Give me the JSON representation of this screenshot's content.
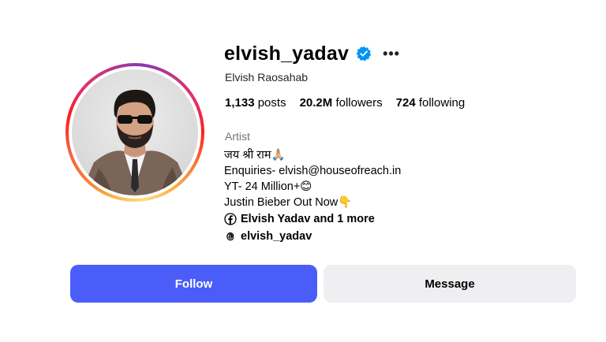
{
  "profile": {
    "username": "elvish_yadav",
    "full_name": "Elvish Raosahab",
    "more_icon": "more-options-icon",
    "verified_icon": "verified-badge-icon",
    "stats": {
      "posts_count": "1,133",
      "posts_label": "posts",
      "followers_count": "20.2M",
      "followers_label": "followers",
      "following_count": "724",
      "following_label": "following"
    },
    "category": "Artist",
    "bio_lines": [
      "जय श्री राम🙏🏼",
      "Enquiries- elvish@houseofreach.in",
      "YT- 24 Million+😊",
      "Justin Bieber Out Now👇"
    ],
    "links": {
      "facebook_text": "Elvish Yadav and 1 more",
      "facebook_icon": "facebook-icon",
      "threads_text": "elvish_yadav",
      "threads_icon": "threads-icon"
    }
  },
  "actions": {
    "follow_label": "Follow",
    "message_label": "Message"
  },
  "colors": {
    "follow_button": "#4a5df9",
    "message_button": "#efeff2",
    "verified_blue": "#0095f6",
    "muted_text": "#737373"
  }
}
